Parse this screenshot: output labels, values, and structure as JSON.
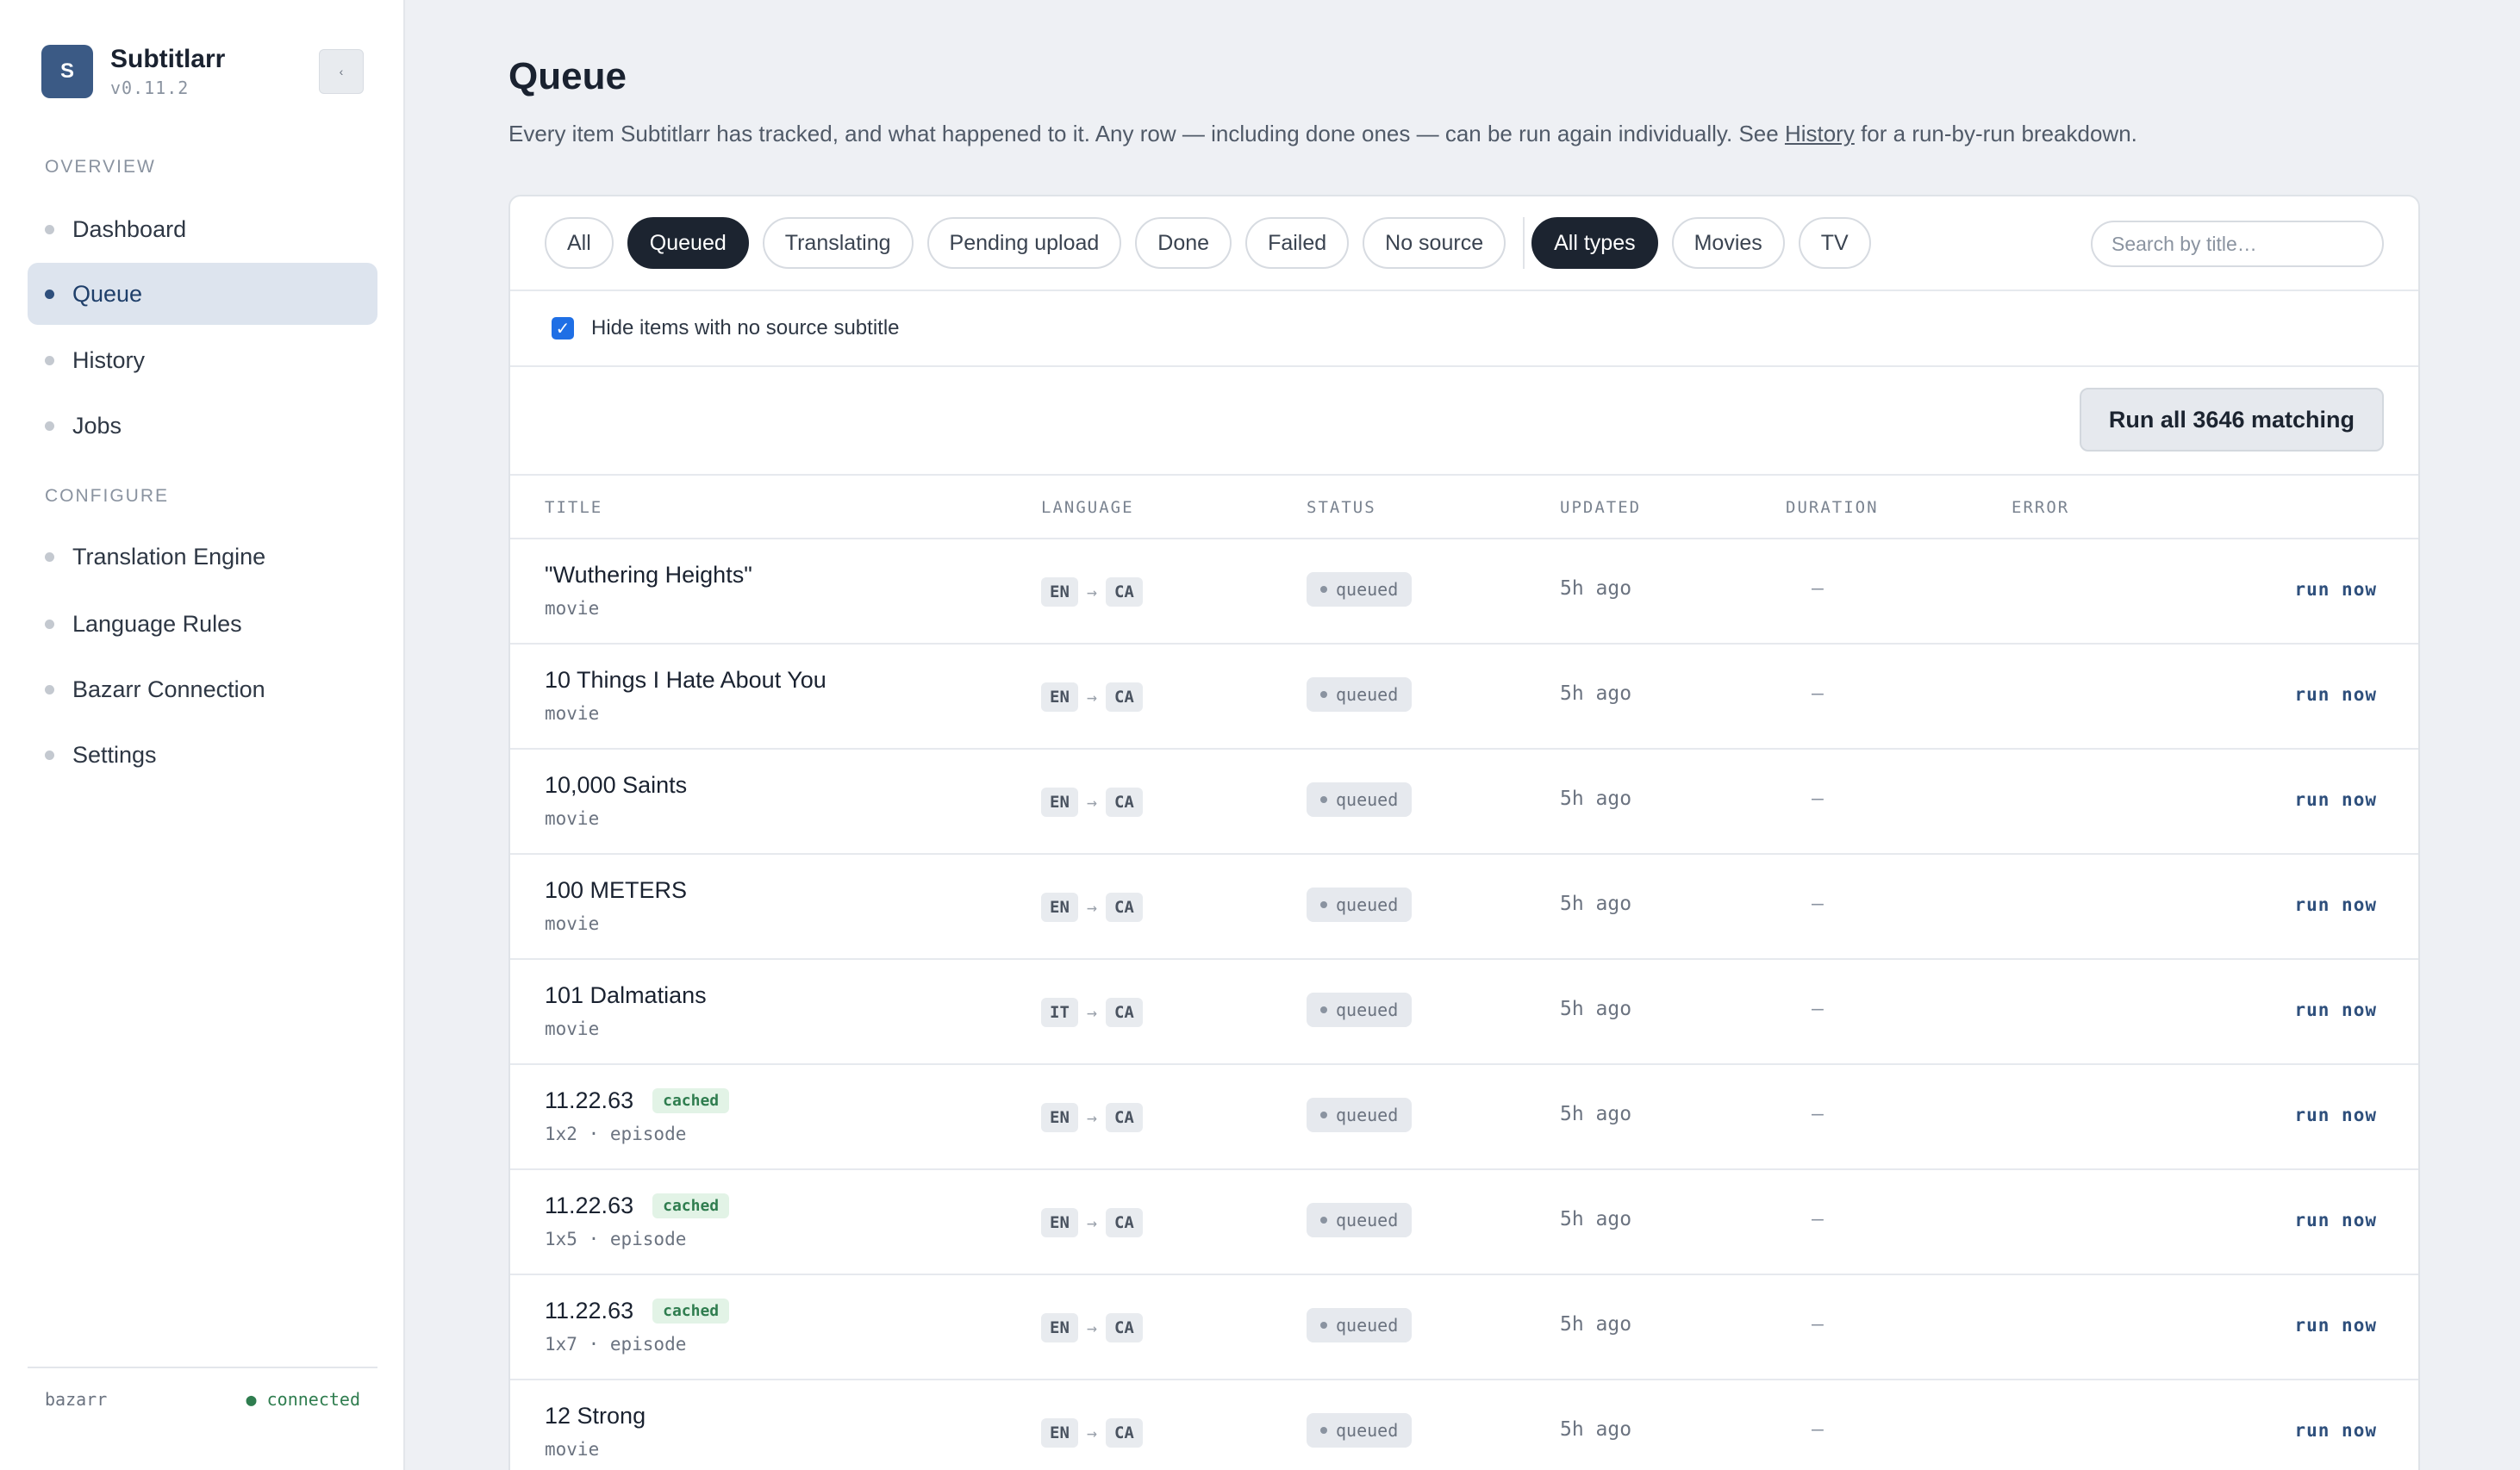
{
  "app": {
    "logo_letter": "S",
    "name": "Subtitlarr",
    "version": "v0.11.2",
    "collapse_icon": "‹"
  },
  "sidebar": {
    "sections": [
      {
        "label": "OVERVIEW",
        "items": [
          "Dashboard",
          "Queue",
          "History",
          "Jobs"
        ]
      },
      {
        "label": "CONFIGURE",
        "items": [
          "Translation Engine",
          "Language Rules",
          "Bazarr Connection",
          "Settings"
        ]
      }
    ],
    "active": "Queue",
    "footer": {
      "source": "bazarr",
      "status": "● connected"
    }
  },
  "page": {
    "title": "Queue",
    "description_before": "Every item Subtitlarr has tracked, and what happened to it. Any row — including done ones — can be run again individually. See ",
    "description_link": "History",
    "description_after": " for a run-by-run breakdown."
  },
  "filters": {
    "status": [
      "All",
      "Queued",
      "Translating",
      "Pending upload",
      "Done",
      "Failed",
      "No source"
    ],
    "status_selected": "Queued",
    "type": [
      "All types",
      "Movies",
      "TV"
    ],
    "type_selected": "All types",
    "search_placeholder": "Search by title…"
  },
  "hide_no_source": {
    "checked": true,
    "label": "Hide items with no source subtitle"
  },
  "run_all_label": "Run all 3646 matching",
  "table": {
    "columns": [
      "TITLE",
      "LANGUAGE",
      "STATUS",
      "UPDATED",
      "DURATION",
      "ERROR"
    ],
    "rows": [
      {
        "title": "\"Wuthering Heights\"",
        "cached": "",
        "sub": "movie",
        "from": "EN",
        "to": "CA",
        "status": "queued",
        "updated": "5h ago",
        "duration": "–",
        "action": "run now"
      },
      {
        "title": "10 Things I Hate About You",
        "cached": "",
        "sub": "movie",
        "from": "EN",
        "to": "CA",
        "status": "queued",
        "updated": "5h ago",
        "duration": "–",
        "action": "run now"
      },
      {
        "title": "10,000 Saints",
        "cached": "",
        "sub": "movie",
        "from": "EN",
        "to": "CA",
        "status": "queued",
        "updated": "5h ago",
        "duration": "–",
        "action": "run now"
      },
      {
        "title": "100 METERS",
        "cached": "",
        "sub": "movie",
        "from": "EN",
        "to": "CA",
        "status": "queued",
        "updated": "5h ago",
        "duration": "–",
        "action": "run now"
      },
      {
        "title": "101 Dalmatians",
        "cached": "",
        "sub": "movie",
        "from": "IT",
        "to": "CA",
        "status": "queued",
        "updated": "5h ago",
        "duration": "–",
        "action": "run now"
      },
      {
        "title": "11.22.63",
        "cached": "cached",
        "sub": "1x2 · episode",
        "from": "EN",
        "to": "CA",
        "status": "queued",
        "updated": "5h ago",
        "duration": "–",
        "action": "run now"
      },
      {
        "title": "11.22.63",
        "cached": "cached",
        "sub": "1x5 · episode",
        "from": "EN",
        "to": "CA",
        "status": "queued",
        "updated": "5h ago",
        "duration": "–",
        "action": "run now"
      },
      {
        "title": "11.22.63",
        "cached": "cached",
        "sub": "1x7 · episode",
        "from": "EN",
        "to": "CA",
        "status": "queued",
        "updated": "5h ago",
        "duration": "–",
        "action": "run now"
      },
      {
        "title": "12 Strong",
        "cached": "",
        "sub": "movie",
        "from": "EN",
        "to": "CA",
        "status": "queued",
        "updated": "5h ago",
        "duration": "–",
        "action": "run now"
      }
    ]
  },
  "colors": {
    "accent": "#2e4f7c",
    "logo": "#3b5a85",
    "connected": "#2f7d4f",
    "chip_active": "#1c2430"
  }
}
